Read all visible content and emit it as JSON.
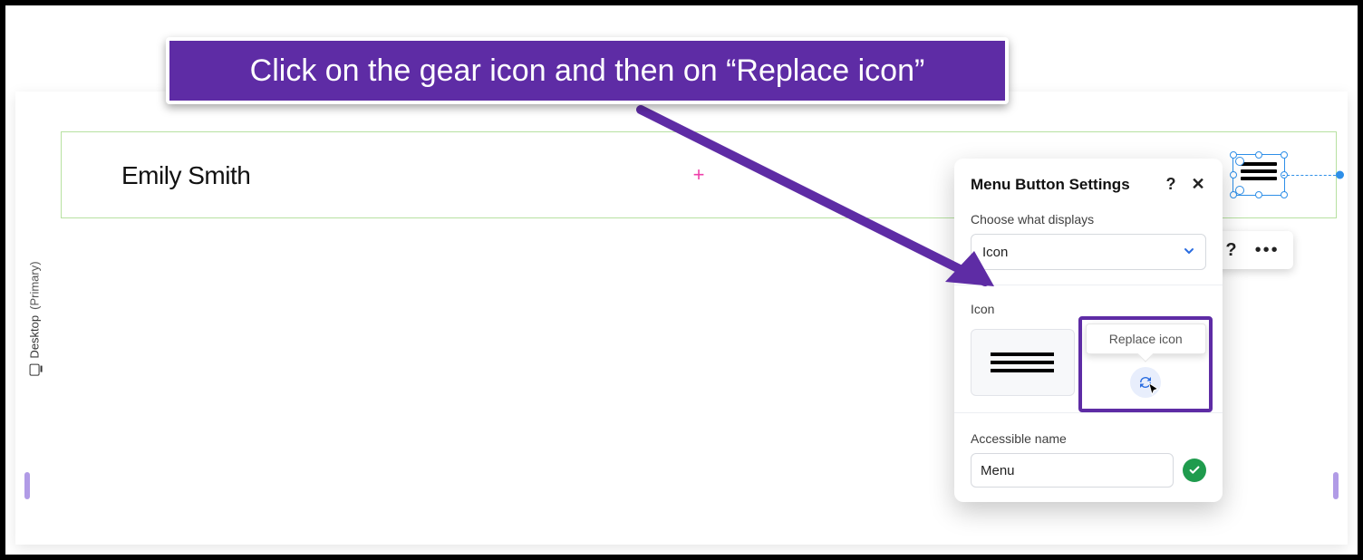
{
  "callout_text": "Click on the gear icon and then on “Replace icon”",
  "viewport_label": {
    "device": "Desktop",
    "mode": "(Primary)"
  },
  "header": {
    "site_title": "Emily Smith"
  },
  "floating_toolbar": {
    "help_icon": "?",
    "more_icon": "•••"
  },
  "panel": {
    "title": "Menu Button Settings",
    "help_icon": "?",
    "close_icon": "✕",
    "section_choose_label": "Choose what displays",
    "display_mode_value": "Icon",
    "section_icon_label": "Icon",
    "replace_tooltip": "Replace icon",
    "section_accessible_label": "Accessible name",
    "accessible_name_value": "Menu"
  }
}
